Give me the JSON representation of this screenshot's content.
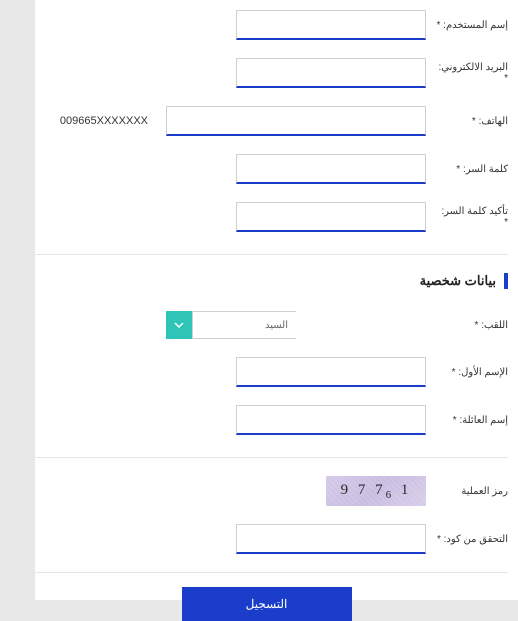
{
  "fields": {
    "username_label": "إسم المستخدم: *",
    "email_label": "البريد الالكتروني: *",
    "phone_label": "الهاتف: *",
    "phone_hint": "009665XXXXXXX",
    "password_label": "كلمة السر: *",
    "confirm_password_label": "تأكيد كلمة السر: *"
  },
  "personal": {
    "section_title": "بيانات شخصية",
    "title_label": "اللقب: *",
    "title_value": "السيد",
    "firstname_label": "الإسم الأول: *",
    "lastname_label": "إسم العائلة: *"
  },
  "captcha": {
    "label": "رمز العملية",
    "verify_label": "التحقق من كود: *",
    "chars": [
      "1",
      "7",
      "6",
      "7",
      "9"
    ]
  },
  "submit_label": "التسجيل"
}
